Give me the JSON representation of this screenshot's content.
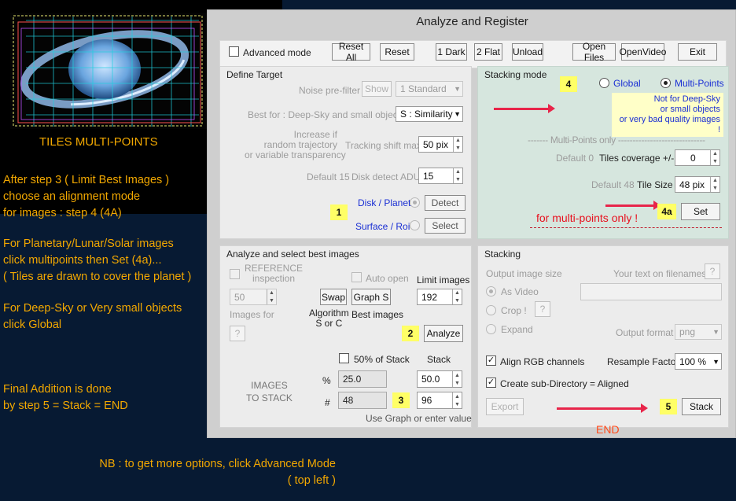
{
  "left": {
    "tiles_caption": "TILES MULTI-POINTS",
    "para1": [
      "After step 3 ( Limit Best Images )",
      "choose an alignment mode",
      "for images   :  step 4 (4A)"
    ],
    "para2": [
      "For Planetary/Lunar/Solar images",
      "click multipoints then Set (4a)...",
      "( Tiles are drawn to cover the planet )"
    ],
    "para3": [
      "For Deep-Sky or Very small objects",
      "click Global"
    ],
    "para4": [
      "Final Addition is done",
      "by step 5    =   Stack  = END"
    ],
    "nb": [
      "NB : to get more options, click Advanced Mode",
      "( top left )"
    ]
  },
  "window": {
    "title": "Analyze and Register",
    "toolbar": {
      "advanced_mode": "Advanced mode",
      "reset_all": "Reset All",
      "reset": "Reset",
      "dark": "1 Dark",
      "flat": "2 Flat",
      "unload": "Unload",
      "open_files": "Open Files",
      "open_video": "OpenVideo",
      "exit": "Exit"
    },
    "define_target": {
      "title": "Define Target",
      "noise_prefilter": "Noise pre-filter",
      "show": "Show",
      "standard": "1 Standard",
      "best_for": "Best for : Deep-Sky and small objects",
      "similarity": "S : Similarity",
      "increase_if": [
        "Increase if",
        "random trajectory",
        "or variable transparency"
      ],
      "tracking_shift": "Tracking shift max",
      "tracking_value": "50 pix",
      "default15": "Default 15",
      "disk_detect": "Disk detect ADU",
      "disk_value": "15",
      "disk_planet": "Disk / Planet",
      "detect": "Detect",
      "surface_roi": "Surface / Roi",
      "select": "Select",
      "badge": "1"
    },
    "stacking_mode": {
      "title": "Stacking mode",
      "badge": "4",
      "global": "Global",
      "multi_points": "Multi-Points",
      "note": [
        "Not for Deep-Sky",
        "or small objects",
        "or very bad quality images !"
      ],
      "multi_only": "------- Multi-Points only ------------------------------",
      "default0": "Default 0",
      "tiles_coverage": "Tiles coverage +/-",
      "tiles_value": "0",
      "default48": "Default 48",
      "tile_size": "Tile Size",
      "tile_value": "48 pix",
      "multi_only_red": "for multi-points only !",
      "badge4a": "4a",
      "set": "Set"
    },
    "analyze": {
      "title": "Analyze and select best images",
      "reference": [
        "REFERENCE",
        "inspection"
      ],
      "auto_open": "Auto open",
      "ref_value": "50",
      "images_for": "Images for",
      "q": "?",
      "swap": "Swap",
      "graph": "Graph S",
      "algorithm": "Algorithm",
      "s_or_c": "S or C",
      "best_images": "Best images",
      "limit_images": "Limit images",
      "limit_value": "192",
      "badge": "2",
      "analyze_btn": "Analyze",
      "fifty_stack": "50% of Stack",
      "stack_lbl": "Stack",
      "images_to_stack": [
        "IMAGES",
        "TO STACK"
      ],
      "pct": "%",
      "hash": "#",
      "pct_value": "25.0",
      "num_value": "48",
      "stack_pct": "50.0",
      "stack_num": "96",
      "badge3": "3",
      "use_graph": "Use Graph or enter value"
    },
    "stacking": {
      "title": "Stacking",
      "output_size": "Output  image size",
      "your_text": "Your text on filenames",
      "q": "?",
      "as_video": "As Video",
      "crop": "Crop !",
      "expand": "Expand",
      "output_format": "Output format",
      "format_value": "png",
      "align_rgb": "Align RGB channels",
      "resample": "Resample Factor",
      "resample_value": "100 %",
      "create_sub": "Create sub-Directory = Aligned",
      "export": "Export",
      "badge5": "5",
      "stack": "Stack",
      "end": "END"
    }
  }
}
